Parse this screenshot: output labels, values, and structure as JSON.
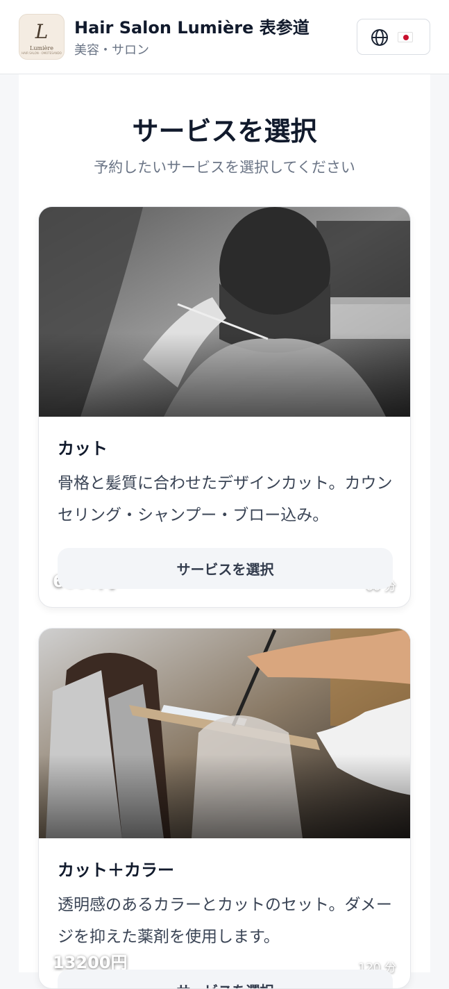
{
  "header": {
    "logo": {
      "letter": "L",
      "word": "Lumière",
      "tagline": "HAIR SALON · OMOTESANDO"
    },
    "salon_name": "Hair Salon Lumière 表参道",
    "category": "美容・サロン",
    "language": {
      "icon": "globe-icon",
      "flag": "japan-flag"
    }
  },
  "main": {
    "title": "サービスを選択",
    "subtitle": "予約したいサービスを選択してください"
  },
  "services": [
    {
      "price": "6600円",
      "duration": "60 分",
      "name": "カット",
      "description": "骨格と髪質に合わせたデザインカット。カウンセリング・シャンプー・ブロー込み。",
      "button_label": "サービスを選択",
      "image": "haircut-photo"
    },
    {
      "price": "13200円",
      "duration": "120 分",
      "name": "カット＋カラー",
      "description": "透明感のあるカラーとカットのセット。ダメージを抑えた薬剤を使用します。",
      "button_label": "サービスを選択",
      "image": "hair-color-photo"
    }
  ],
  "colors": {
    "background": "#f6f7f9",
    "card": "#ffffff",
    "title": "#111a2c",
    "muted": "#6b7586",
    "button_bg": "#f3f5f8"
  }
}
